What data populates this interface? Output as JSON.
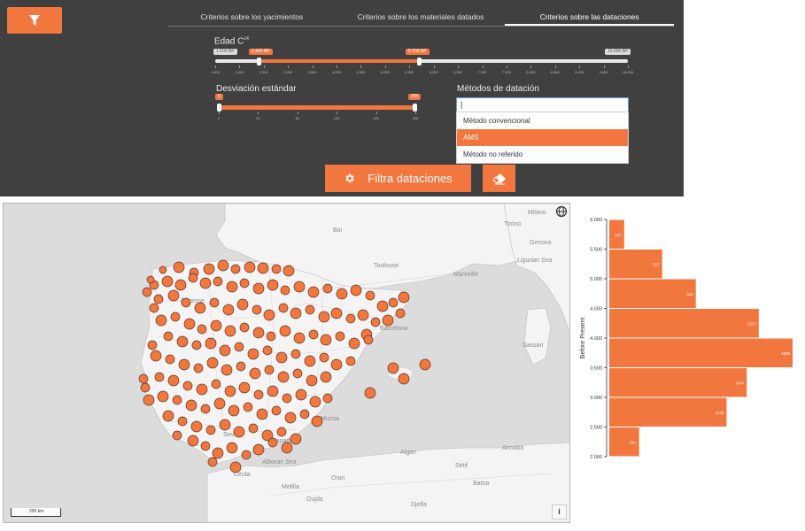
{
  "tabs": [
    {
      "label": "Criterios sobre los yacimientos",
      "active": false
    },
    {
      "label": "Criterios sobre los materiales datados",
      "active": false
    },
    {
      "label": "Criterios sobre las dataciones",
      "active": true
    }
  ],
  "age": {
    "label_text": "Edad C",
    "label_sup": "14",
    "range_min_label": "1.500 BP",
    "selected_low_label": "2.400 BP",
    "selected_high_label": "5.700 BP",
    "range_max_label": "10.000 BP",
    "ticks": [
      "1.500",
      "2.000",
      "2.500",
      "3.000",
      "3.500",
      "4.000",
      "4.500",
      "5.000",
      "5.500",
      "6.000",
      "6.500",
      "7.000",
      "7.500",
      "8.000",
      "8.500",
      "9.000",
      "9.500",
      "10.000"
    ],
    "selection_fraction": [
      0.106,
      0.494
    ]
  },
  "deviation": {
    "label": "Desviación estándar",
    "min_label": "0",
    "max_label": "200",
    "ticks": [
      "0",
      "40",
      "80",
      "120",
      "160",
      "200"
    ],
    "selection_fraction": [
      0.0,
      1.0
    ]
  },
  "methods": {
    "label": "Métodos de datación",
    "input_value": "",
    "options": [
      {
        "label": "Método convencional",
        "selected": false
      },
      {
        "label": "AMS",
        "selected": true
      },
      {
        "label": "Método no referido",
        "selected": false
      }
    ]
  },
  "buttons": {
    "filter_label": "Filtra dataciones"
  },
  "map": {
    "place_labels": [
      "Milano",
      "Torino",
      "Genova",
      "Boi",
      "Toulouse",
      "Marseille",
      "Ligurian Sea",
      "Ourense",
      "Barcelona",
      "Sassari",
      "Murcia",
      "Sevilla",
      "Granada",
      "Alboran Sea",
      "Ceuta",
      "Algier",
      "Annaba",
      "Sétif",
      "Batna",
      "Oran",
      "Melilla",
      "Oujda",
      "Djelfa"
    ],
    "scale_label": "200 km",
    "info_label": "i"
  },
  "colors": {
    "accent": "#f2773f",
    "panel_bg": "#404040",
    "sea": "#dcdcdc",
    "land": "#f5f5f5"
  },
  "chart_data": {
    "type": "bar",
    "orientation": "horizontal",
    "ylabel": "Before Present",
    "y_ticks": [
      "6.000",
      "5.500",
      "5.000",
      "4.500",
      "4.000",
      "3.500",
      "3.000",
      "2.500",
      "2.000"
    ],
    "bins": [
      {
        "from": 5500,
        "to": 6000,
        "value": 157
      },
      {
        "from": 5000,
        "to": 5500,
        "value": 557
      },
      {
        "from": 4500,
        "to": 5000,
        "value": 911
      },
      {
        "from": 4000,
        "to": 4500,
        "value": 1574
      },
      {
        "from": 3500,
        "to": 4000,
        "value": 1930
      },
      {
        "from": 3000,
        "to": 3500,
        "value": 1447
      },
      {
        "from": 2500,
        "to": 3000,
        "value": 1235
      },
      {
        "from": 2000,
        "to": 2500,
        "value": 314
      }
    ]
  }
}
